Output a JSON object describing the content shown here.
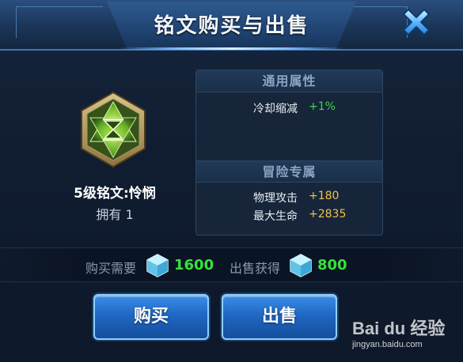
{
  "header": {
    "title": "铭文购买与出售"
  },
  "inscription": {
    "name": "5级铭文:怜悯",
    "owned": "拥有 1"
  },
  "attributes": {
    "general_title": "通用属性",
    "general": [
      {
        "label": "冷却缩减",
        "value": "+1%",
        "color": "#3fd54a"
      }
    ],
    "adventure_title": "冒险专属",
    "adventure": [
      {
        "label": "物理攻击",
        "value": "+180",
        "color": "#f0c14b"
      },
      {
        "label": "最大生命",
        "value": "+2835",
        "color": "#f0c14b"
      }
    ]
  },
  "price": {
    "buy_label": "购买需要",
    "buy_value": "1600",
    "sell_label": "出售获得",
    "sell_value": "800",
    "currency_icon": "crystal-gem-icon"
  },
  "buttons": {
    "buy": "购买",
    "sell": "出售"
  },
  "watermark": {
    "logo": "Bai du 经验",
    "url": "jingyan.baidu.com"
  },
  "colors": {
    "accent": "#3c8ee6",
    "positive": "#36e23a",
    "gold": "#f0c14b"
  }
}
